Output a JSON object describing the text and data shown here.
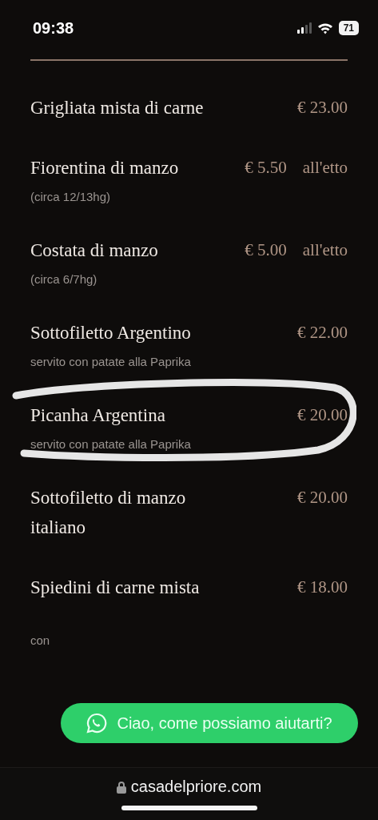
{
  "status_bar": {
    "time": "09:38",
    "battery": "71"
  },
  "menu": [
    {
      "name": "Grigliata mista di carne",
      "price": "€ 23.00",
      "circled": false
    },
    {
      "name": "Fiorentina di manzo",
      "price": "€ 5.50",
      "unit": "all'etto",
      "note": "(circa 12/13hg)",
      "circled": false
    },
    {
      "name": "Costata di manzo",
      "price": "€ 5.00",
      "unit": "all'etto",
      "note": "(circa 6/7hg)",
      "circled": false
    },
    {
      "name": "Sottofiletto Argentino",
      "price": "€ 22.00",
      "note": "servito con patate alla Paprika",
      "circled": false
    },
    {
      "name": "Picanha Argentina",
      "price": "€ 20.00",
      "note": "servito con patate alla Paprika",
      "circled": true
    },
    {
      "name": "Sottofiletto di manzo italiano",
      "price": "€ 20.00",
      "circled": false
    },
    {
      "name": "Spiedini di carne mista",
      "price": "€ 18.00",
      "circled": false
    },
    {
      "note": "con",
      "circled": false
    }
  ],
  "chat_button": {
    "label": "Ciao, come possiamo aiutarti?"
  },
  "address_bar": {
    "url": "casadelpriore.com"
  }
}
